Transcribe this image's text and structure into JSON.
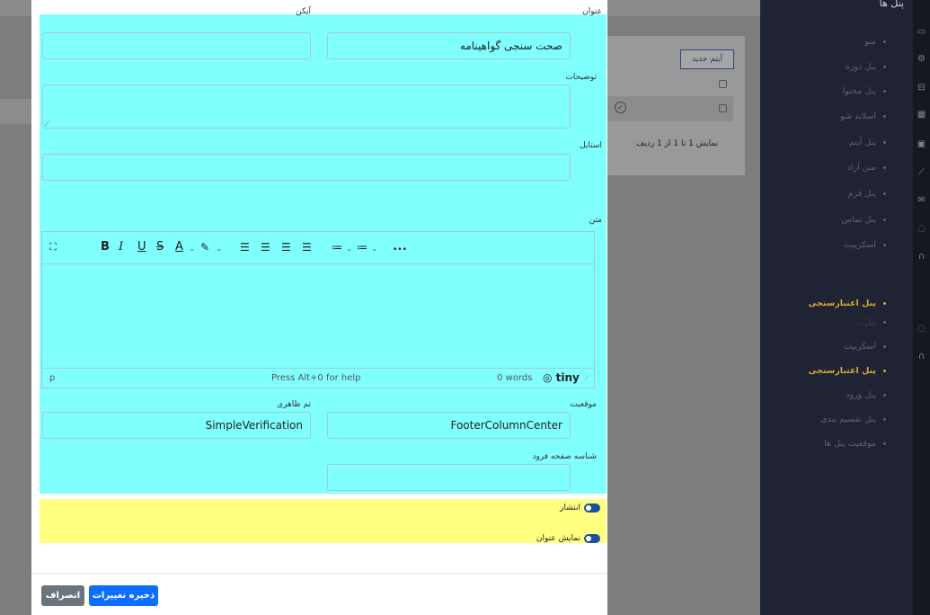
{
  "background": {
    "new_item_label": "آیتم جدید",
    "row_count_text": "نمایش 1 تا 1 از 1 ردیف",
    "check_glyph": "✓"
  },
  "sidebar": {
    "title": "پنل ها",
    "items": [
      {
        "label": "منو",
        "active": false
      },
      {
        "label": "پنل دوره",
        "active": false
      },
      {
        "label": "پنل محتوا",
        "active": false
      },
      {
        "label": "اسلاید شو",
        "active": false
      },
      {
        "label": "پنل آیتم",
        "active": false
      },
      {
        "label": "متن آزاد",
        "active": false
      },
      {
        "label": "پنل فرم",
        "active": false
      },
      {
        "label": "پنل تماس",
        "active": false
      },
      {
        "label": "اسکریپت",
        "active": false
      },
      {
        "label": "پنل اعتبارسنجی",
        "active": true
      },
      {
        "label": "پنل ...",
        "active": false
      },
      {
        "label": "اسکریپت",
        "active": false
      },
      {
        "label": "پنل اعتبارسنجی",
        "active": true
      },
      {
        "label": "پنل ورود",
        "active": false
      },
      {
        "label": "پنل تقسیم بندی",
        "active": false
      },
      {
        "label": "موقعیت پنل ها",
        "active": false
      }
    ],
    "accent_color": "#d4a93a"
  },
  "rail_icons": [
    "monitor-icon",
    "gear-icon",
    "basket-icon",
    "grid-icon",
    "image-icon",
    "chart-icon",
    "mail-icon",
    "chat-icon",
    "headset-icon",
    "chat-icon",
    "headset-icon"
  ],
  "form": {
    "title_label": "عنوان",
    "title_value": "صحت سنجی گواهینامه",
    "icon_label": "آیکن",
    "icon_value": "",
    "description_label": "توضیحات",
    "description_value": "",
    "style_label": "استایل",
    "style_value": "",
    "text_label": "متن",
    "editor": {
      "toolbar": [
        "fullscreen-icon",
        "bold",
        "italic",
        "underline",
        "strikethrough",
        "text-color",
        "highlight",
        "align-left",
        "align-center",
        "align-right",
        "justify",
        "bullet-list",
        "numbered-list",
        "more"
      ],
      "bold_glyph": "B",
      "italic_glyph": "I",
      "underline_glyph": "U",
      "strike_glyph": "S",
      "color_glyph": "A",
      "more_glyph": "•••",
      "status_path": "p",
      "help_text": "Press Alt+0 for help",
      "word_count": "0 words",
      "brand": "tiny"
    },
    "position_label": "موقعیت",
    "position_value": "FooterColumnCenter",
    "theme_label": "تم ظاهری",
    "theme_value": "SimpleVerification",
    "landing_id_label": "شناسه صفحه فرود",
    "landing_id_value": "",
    "publish_label": "انتشار",
    "show_title_label": "نمایش عنوان"
  },
  "footer": {
    "save_label": "ذخیره تغییرات",
    "cancel_label": "انصراف"
  },
  "colors": {
    "form_highlight": "#80ffff",
    "toggle_highlight": "#ffff80",
    "primary": "#0d6efd",
    "secondary": "#6c757d"
  }
}
